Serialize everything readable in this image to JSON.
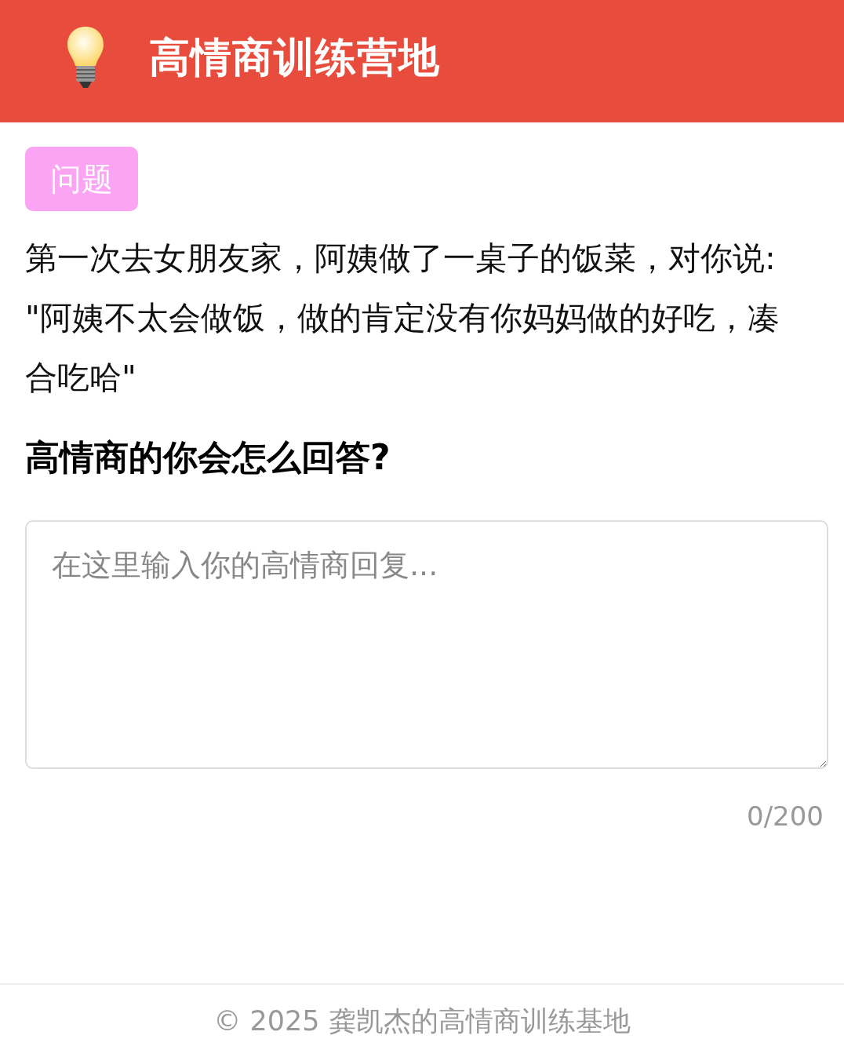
{
  "header": {
    "title": "高情商训练营地"
  },
  "tag": "问题",
  "question_lines": [
    "第一次去女朋友家，阿姨做了一桌子的饭菜，对你说:",
    "\"阿姨不太会做饭，做的肯定没有你妈妈做的好吃，凑合吃哈\""
  ],
  "prompt": "高情商的你会怎么回答?",
  "answer": {
    "placeholder": "在这里输入你的高情商回复...",
    "counter": "0/200"
  },
  "footer": "© 2025 龚凯杰的高情商训练基地"
}
